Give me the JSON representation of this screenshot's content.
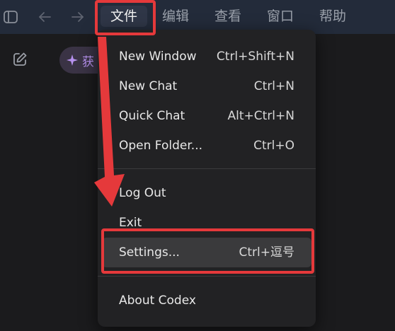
{
  "toolbar": {
    "sidebar_icon": "sidebar-toggle-icon",
    "back_icon": "arrow-left-icon",
    "forward_icon": "arrow-right-icon"
  },
  "menubar": {
    "items": [
      {
        "label": "文件",
        "active": true
      },
      {
        "label": "编辑",
        "active": false
      },
      {
        "label": "查看",
        "active": false
      },
      {
        "label": "窗口",
        "active": false
      },
      {
        "label": "帮助",
        "active": false
      }
    ]
  },
  "sidebar": {
    "new_chat_icon": "edit-icon",
    "pill_icon": "sparkle-icon",
    "pill_text": "获"
  },
  "file_menu": {
    "group1": [
      {
        "label": "New Window",
        "shortcut": "Ctrl+Shift+N"
      },
      {
        "label": "New Chat",
        "shortcut": "Ctrl+N"
      },
      {
        "label": "Quick Chat",
        "shortcut": "Alt+Ctrl+N"
      },
      {
        "label": "Open Folder...",
        "shortcut": "Ctrl+O"
      }
    ],
    "group2": [
      {
        "label": "Log Out",
        "shortcut": ""
      },
      {
        "label": "Exit",
        "shortcut": ""
      },
      {
        "label": "Settings...",
        "shortcut": "Ctrl+逗号",
        "highlighted": true
      }
    ],
    "group3": [
      {
        "label": "About Codex",
        "shortcut": ""
      }
    ]
  },
  "colors": {
    "menubar_bg": "#232b3a",
    "dropdown_bg": "#222224",
    "highlight_bg": "#3a3a3c",
    "annotation_red": "#e5393b",
    "accent_purple": "#b892f0"
  }
}
